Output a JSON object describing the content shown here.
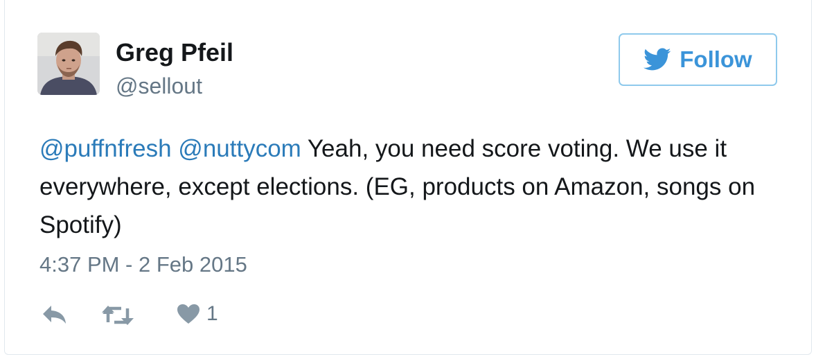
{
  "user": {
    "name": "Greg Pfeil",
    "handle": "@sellout"
  },
  "follow_button": {
    "label": "Follow",
    "icon": "twitter-bird-icon"
  },
  "tweet": {
    "mentions": [
      "@puffnfresh",
      "@nuttycom"
    ],
    "body": " Yeah, you need score voting. We use it everywhere, except elections. (EG, products on Amazon, songs on Spotify)",
    "timestamp": "4:37 PM - 2 Feb 2015"
  },
  "actions": {
    "reply_icon": "reply-icon",
    "retweet_icon": "retweet-icon",
    "like_icon": "heart-icon",
    "like_count": "1"
  },
  "colors": {
    "mention": "#2b7bb9",
    "follow_accent": "#3b94d9",
    "secondary_text": "#657786",
    "action_icon": "#8899a6"
  }
}
